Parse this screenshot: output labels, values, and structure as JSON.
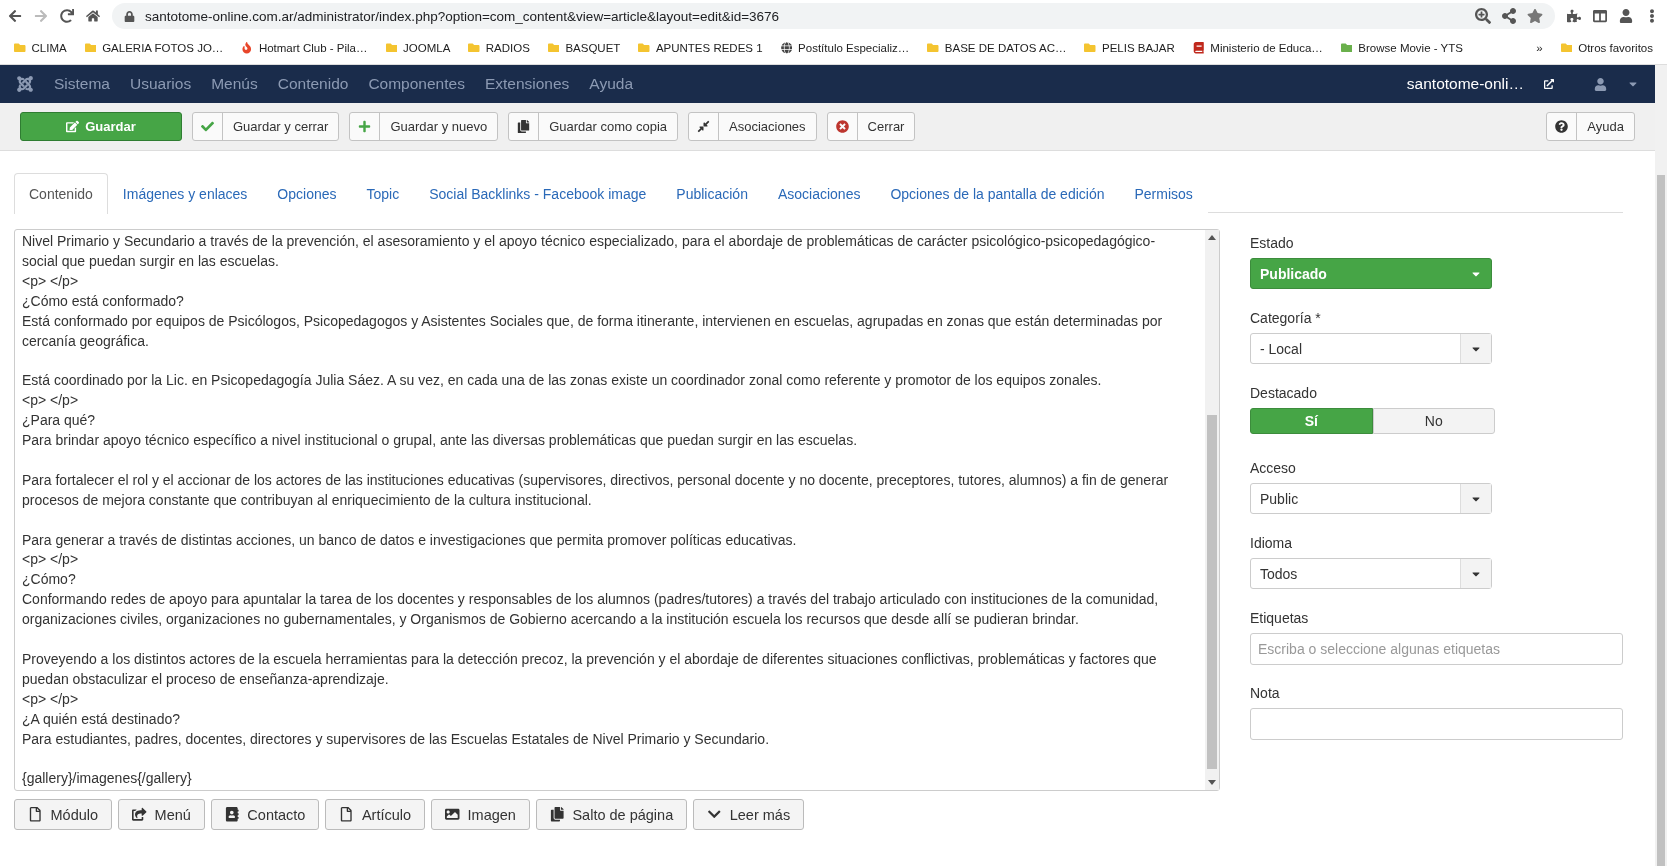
{
  "browser": {
    "url": "santotome-online.com.ar/administrator/index.php?option=com_content&view=article&layout=edit&id=3676",
    "bookmarks": [
      {
        "label": "CLIMA",
        "kind": "folder"
      },
      {
        "label": "GALERIA FOTOS JO…",
        "kind": "folder"
      },
      {
        "label": "Hotmart Club - Pila…",
        "kind": "flame"
      },
      {
        "label": "JOOMLA",
        "kind": "folder"
      },
      {
        "label": "RADIOS",
        "kind": "folder"
      },
      {
        "label": "BASQUET",
        "kind": "folder"
      },
      {
        "label": "APUNTES REDES 1",
        "kind": "folder"
      },
      {
        "label": "Postítulo Especializ…",
        "kind": "globe"
      },
      {
        "label": "BASE DE DATOS AC…",
        "kind": "folder"
      },
      {
        "label": "PELIS BAJAR",
        "kind": "folder"
      },
      {
        "label": "Ministerio de Educa…",
        "kind": "book"
      },
      {
        "label": "Browse Movie - YTS",
        "kind": "yts"
      }
    ],
    "more": "»",
    "other": "Otros favoritos"
  },
  "nav": {
    "items": [
      "Sistema",
      "Usuarios",
      "Menús",
      "Contenido",
      "Componentes",
      "Extensiones",
      "Ayuda"
    ],
    "site": "santotome-onli…"
  },
  "toolbar": {
    "buttons": [
      {
        "label": "Guardar",
        "kind": "primary"
      },
      {
        "label": "Guardar y cerrar",
        "kind": "default"
      },
      {
        "label": "Guardar y nuevo",
        "kind": "default"
      },
      {
        "label": "Guardar como copia",
        "kind": "default"
      },
      {
        "label": "Asociaciones",
        "kind": "default"
      },
      {
        "label": "Cerrar",
        "kind": "default"
      }
    ],
    "help": "Ayuda"
  },
  "tabs": [
    {
      "label": "Contenido",
      "selected": true
    },
    {
      "label": "Imágenes y enlaces",
      "selected": false
    },
    {
      "label": "Opciones",
      "selected": false
    },
    {
      "label": "Topic",
      "selected": false
    },
    {
      "label": "Social Backlinks - Facebook image",
      "selected": false
    },
    {
      "label": "Publicación",
      "selected": false
    },
    {
      "label": "Asociaciones",
      "selected": false
    },
    {
      "label": "Opciones de la pantalla de edición",
      "selected": false
    },
    {
      "label": "Permisos",
      "selected": false
    }
  ],
  "editor": {
    "blocks": [
      [
        "Nivel Primario y Secundario a través de la prevención, el asesoramiento y el apoyo técnico especializado, para el abordaje de problemáticas de carácter psicológico-psicopedagógico-",
        "social que puedan surgir en las escuelas.",
        "<p> </p>",
        "¿Cómo está conformado?",
        "Está conformado por equipos de Psicólogos, Psicopedagogos y Asistentes Sociales que, de forma itinerante, intervienen en escuelas, agrupadas en zonas que están determinadas por",
        "cercanía geográfica."
      ],
      [
        "Está coordinado por la Lic. en Psicopedagogía Julia Sáez. A su vez, en cada una de las zonas existe un coordinador zonal como referente y promotor de los equipos zonales.",
        "<p> </p>",
        "¿Para qué?",
        "Para brindar apoyo técnico específico a nivel institucional o grupal, ante las diversas problemáticas que puedan surgir en las escuelas."
      ],
      [
        "Para fortalecer el rol y el accionar de los actores de las instituciones educativas (supervisores, directivos, personal docente y no docente, preceptores, tutores, alumnos) a fin de generar",
        "procesos de mejora constante que contribuyan al enriquecimiento de la cultura institucional."
      ],
      [
        "Para generar a través de distintas acciones, un banco de datos e investigaciones que permita promover políticas educativas.",
        "<p> </p>",
        "¿Cómo?",
        "Conformando redes de apoyo para apuntalar la tarea de los docentes y responsables de los alumnos (padres/tutores) a través del trabajo articulado con instituciones de la comunidad,",
        "organizaciones civiles, organizaciones no gubernamentales, y Organismos de Gobierno acercando a la institución escuela los recursos que desde allí se pudieran brindar."
      ],
      [
        "Proveyendo a los distintos actores de la escuela herramientas para la detección precoz, la prevención y el abordaje de diferentes situaciones conflictivas, problemáticas y factores que",
        "puedan obstaculizar el proceso de enseñanza-aprendizaje.",
        "<p> </p>",
        "¿A quién está destinado?",
        "Para estudiantes, padres, docentes, directores y supervisores de las Escuelas Estatales de Nivel Primario y Secundario."
      ],
      [
        "{gallery}/imagenes{/gallery}"
      ]
    ],
    "buttons": [
      "Módulo",
      "Menú",
      "Contacto",
      "Artículo",
      "Imagen",
      "Salto de página",
      "Leer más"
    ]
  },
  "fields": [
    {
      "label": "Estado",
      "kind": "status",
      "value": "Publicado"
    },
    {
      "label": "Categoría *",
      "kind": "select",
      "value": "- Local"
    },
    {
      "label": "Destacado",
      "kind": "toggle",
      "options": [
        {
          "label": "Sí",
          "selected": true
        },
        {
          "label": "No",
          "selected": false
        }
      ]
    },
    {
      "label": "Acceso",
      "kind": "select",
      "value": "Public"
    },
    {
      "label": "Idioma",
      "kind": "select",
      "value": "Todos"
    },
    {
      "label": "Etiquetas",
      "kind": "input",
      "placeholder": "Escriba o seleccione algunas etiquetas"
    },
    {
      "label": "Nota",
      "kind": "input"
    }
  ]
}
